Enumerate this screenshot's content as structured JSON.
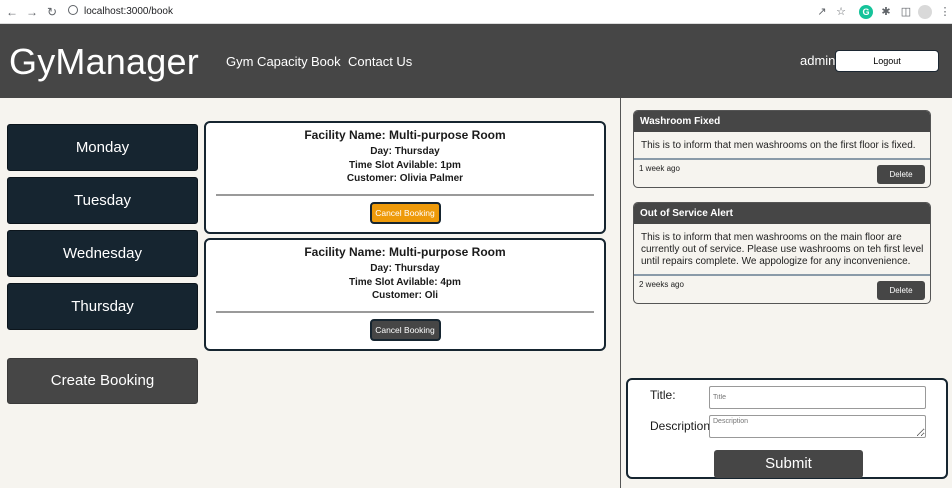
{
  "browser": {
    "url": "localhost:3000/book"
  },
  "header": {
    "brand": "GyManager",
    "nav": [
      "Gym Capacity",
      "Book",
      "Contact Us"
    ],
    "user": "admin",
    "logout_label": "Logout"
  },
  "days": [
    "Monday",
    "Tuesday",
    "Wednesday",
    "Thursday"
  ],
  "create_booking_label": "Create Booking",
  "bookings": [
    {
      "facility": "Facility Name: Multi-purpose Room",
      "day": "Day: Thursday",
      "time": "Time Slot Avilable: 1pm",
      "customer": "Customer: Olivia Palmer",
      "cancel_label": "Cancel Booking"
    },
    {
      "facility": "Facility Name: Multi-purpose Room",
      "day": "Day: Thursday",
      "time": "Time Slot Avilable: 4pm",
      "customer": "Customer: Oli",
      "cancel_label": "Cancel Booking"
    }
  ],
  "announcements": [
    {
      "title": "Washroom Fixed",
      "message": "This is to inform that men washrooms on the first floor is fixed.",
      "time": "1 week ago",
      "delete_label": "Delete"
    },
    {
      "title": "Out of Service Alert",
      "message": "This is to inform that men washrooms on the main floor are currently out of service. Please use washrooms on teh first level until repairs complete. We appologize for any inconvenience.",
      "time": "2 weeks ago",
      "delete_label": "Delete"
    }
  ],
  "form": {
    "title_label": "Title:",
    "title_placeholder": "Title",
    "description_label": "Description",
    "description_placeholder": "Description",
    "submit_label": "Submit"
  },
  "colors": {
    "header_bg": "#464646",
    "day_button_bg": "#162530",
    "cancel_highlight": "#ee9a0a",
    "page_bg": "#f6f4ef"
  }
}
